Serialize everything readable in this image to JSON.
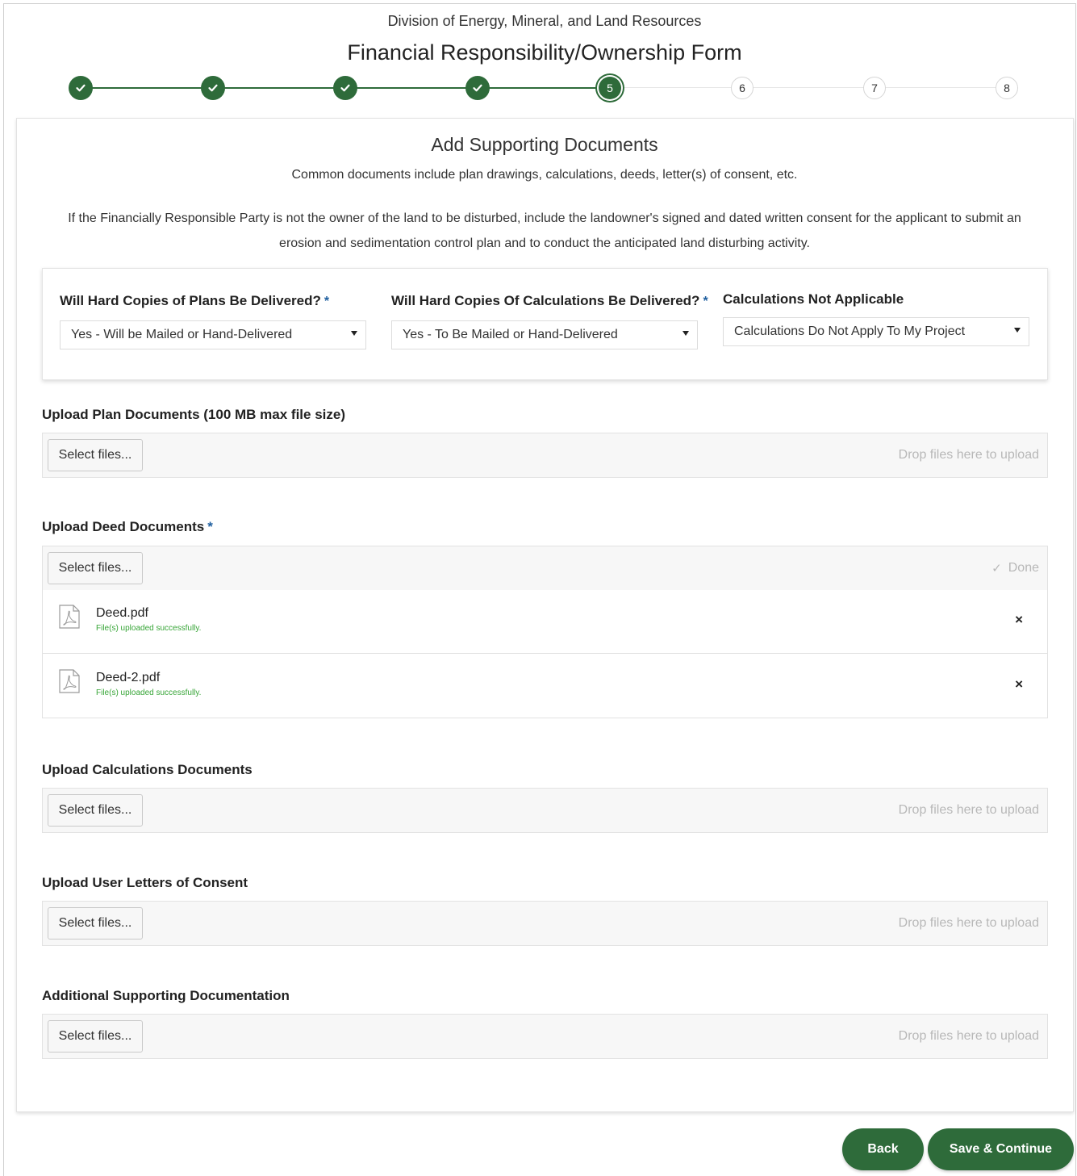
{
  "header": {
    "division": "Division of Energy, Mineral, and Land Resources",
    "title": "Financial Responsibility/Ownership Form"
  },
  "stepper": {
    "current_step": 5,
    "total_steps": 8,
    "steps": [
      {
        "label": "",
        "state": "done",
        "icon": "check-icon"
      },
      {
        "label": "",
        "state": "done",
        "icon": "check-icon"
      },
      {
        "label": "",
        "state": "done",
        "icon": "check-icon"
      },
      {
        "label": "",
        "state": "done",
        "icon": "check-icon"
      },
      {
        "label": "5",
        "state": "current"
      },
      {
        "label": "6",
        "state": "todo"
      },
      {
        "label": "7",
        "state": "todo"
      },
      {
        "label": "8",
        "state": "todo"
      }
    ]
  },
  "section": {
    "title": "Add Supporting Documents",
    "subtitle": "Common documents include plan drawings, calculations, deeds, letter(s) of consent, etc.",
    "note": "If the Financially Responsible Party is not the owner of the land to be disturbed, include the landowner's signed and dated written consent for the applicant to submit an erosion and sedimentation control plan and to conduct the anticipated land disturbing activity."
  },
  "selects": {
    "plans": {
      "label": "Will Hard Copies of Plans Be Delivered?",
      "required_mark": "*",
      "value": "Yes - Will be Mailed or Hand-Delivered"
    },
    "calculations": {
      "label": "Will Hard Copies Of Calculations Be Delivered?",
      "required_mark": "*",
      "value": "Yes - To Be Mailed or Hand-Delivered"
    },
    "not_applicable": {
      "label": "Calculations Not Applicable",
      "value": "Calculations Do Not Apply To My Project"
    }
  },
  "uploads": {
    "select_label": "Select files...",
    "drop_hint": "Drop files here to upload",
    "plan": {
      "label": "Upload Plan Documents (100 MB max file size)"
    },
    "deed": {
      "label": "Upload Deed Documents",
      "required_mark": "*",
      "status": "Done",
      "files": [
        {
          "name": "Deed.pdf",
          "status": "File(s) uploaded successfully.",
          "remove": "×"
        },
        {
          "name": "Deed-2.pdf",
          "status": "File(s) uploaded successfully.",
          "remove": "×"
        }
      ]
    },
    "calculations": {
      "label": "Upload Calculations Documents"
    },
    "consent": {
      "label": "Upload User Letters of Consent"
    },
    "additional": {
      "label": "Additional Supporting Documentation"
    }
  },
  "actions": {
    "back": "Back",
    "save_continue": "Save & Continue"
  },
  "colors": {
    "accent": "#2e6b3a",
    "required": "#1f5f9f",
    "success_text": "#37a537"
  }
}
